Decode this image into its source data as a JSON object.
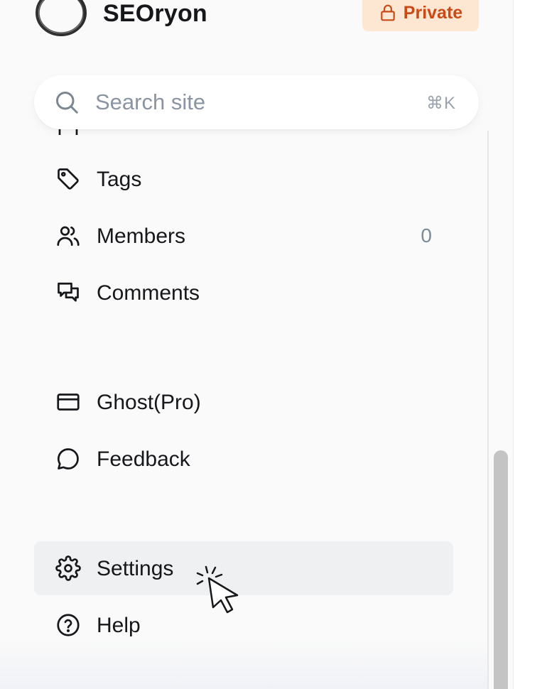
{
  "site": {
    "title": "SEOryon",
    "badge": "Private"
  },
  "search": {
    "placeholder": "Search site",
    "shortcut": "⌘K"
  },
  "nav": {
    "tags": {
      "label": "Tags",
      "icon": "tag-icon"
    },
    "members": {
      "label": "Members",
      "count": "0",
      "icon": "members-icon"
    },
    "comments": {
      "label": "Comments",
      "icon": "comments-icon"
    },
    "ghost_pro": {
      "label": "Ghost(Pro)",
      "icon": "credit-card-icon"
    },
    "feedback": {
      "label": "Feedback",
      "icon": "chat-bubble-icon"
    },
    "settings": {
      "label": "Settings",
      "icon": "gear-icon"
    },
    "help": {
      "label": "Help",
      "icon": "help-circle-icon"
    }
  },
  "colors": {
    "badge_bg": "#fde7d2",
    "badge_text": "#c94a17",
    "active_item_bg": "#eff0f2",
    "sidebar_bg": "#fafafa"
  }
}
